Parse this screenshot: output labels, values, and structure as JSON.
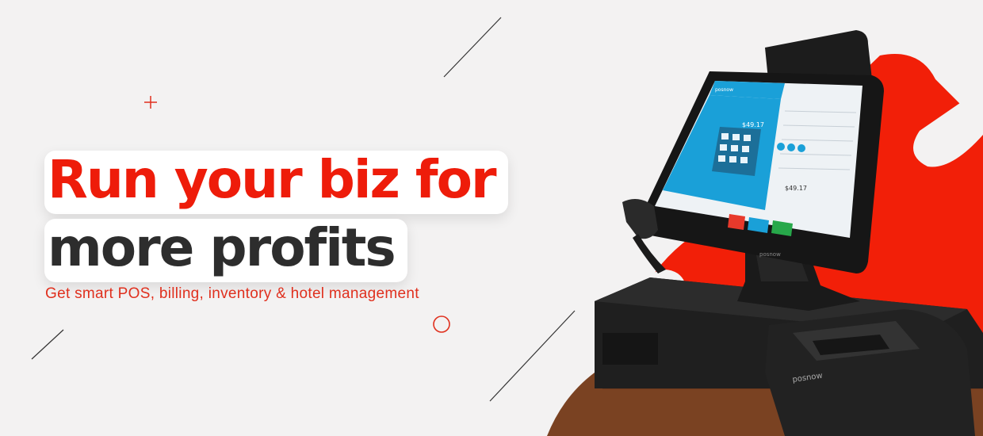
{
  "headline": {
    "line1": "Run your biz for",
    "line2": "more profits"
  },
  "subtitle": "Get smart POS, billing, inventory & hotel management",
  "pos_screen": {
    "brand": "posnow",
    "total_primary": "$49.17",
    "total_secondary": "$49.17"
  },
  "device_brand_stand": "posnow",
  "device_brand_printer": "posnow",
  "colors": {
    "accent_red": "#ee1c0a",
    "dark_text": "#2d2d2d",
    "background": "#f3f2f2",
    "screen_blue": "#1aa0d8",
    "device_black": "#1c1c1c",
    "wood": "#6b3a1c"
  },
  "icons": [
    "plus-mark",
    "circle-mark",
    "diagonal-line"
  ]
}
